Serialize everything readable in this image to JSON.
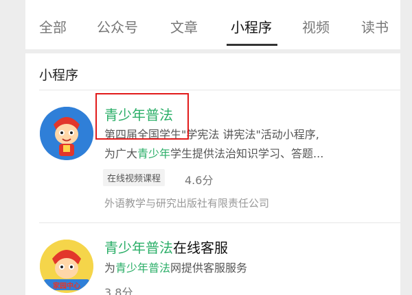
{
  "tabs": [
    {
      "label": "全部"
    },
    {
      "label": "公众号"
    },
    {
      "label": "文章"
    },
    {
      "label": "小程序",
      "active": true
    },
    {
      "label": "视频"
    },
    {
      "label": "读书"
    }
  ],
  "section": {
    "title": "小程序"
  },
  "results": [
    {
      "title_highlight": "青少年普法",
      "title_rest": "",
      "desc_line1": "第四届全国学生\"学宪法 讲宪法\"活动小程序,",
      "desc_line2_prefix": "为广大",
      "desc_line2_highlight": "青少年",
      "desc_line2_suffix": "学生提供法治知识学习、答题...",
      "tag": "在线视频课程",
      "rating": "4.6分",
      "company": "外语教学与研究出版社有限责任公司"
    },
    {
      "title_highlight": "青少年普法",
      "title_rest": "在线客服",
      "desc_prefix": "为",
      "desc_highlight": "青少年普法",
      "desc_suffix": "网提供客服服务",
      "rating": "3.8分",
      "avatar_caption": "家园中心"
    }
  ],
  "colors": {
    "highlight": "#2aae67",
    "annotation": "#e11919"
  }
}
